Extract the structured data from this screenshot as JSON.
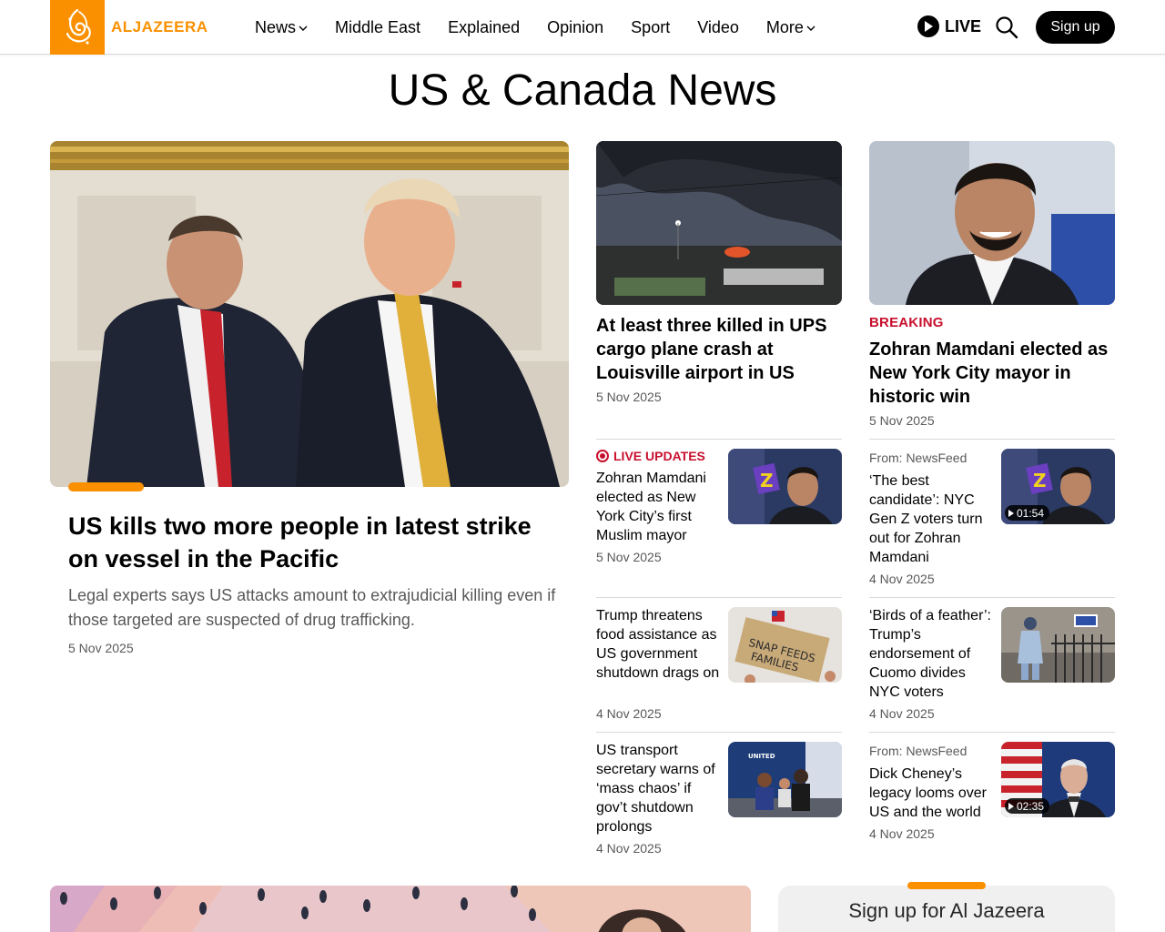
{
  "brand": {
    "logo_text": "ALJAZEERA",
    "accent_color": "#fa9000",
    "breaking_color": "#c8102e"
  },
  "nav": {
    "items": [
      {
        "label": "News",
        "has_dropdown": true
      },
      {
        "label": "Middle East",
        "has_dropdown": false
      },
      {
        "label": "Explained",
        "has_dropdown": false
      },
      {
        "label": "Opinion",
        "has_dropdown": false
      },
      {
        "label": "Sport",
        "has_dropdown": false
      },
      {
        "label": "Video",
        "has_dropdown": false
      },
      {
        "label": "More",
        "has_dropdown": true
      }
    ],
    "live_label": "LIVE",
    "signup_label": "Sign up",
    "icons": [
      "play-icon",
      "search-icon",
      "chevron-down-icon"
    ]
  },
  "page": {
    "title": "US & Canada News"
  },
  "hero": {
    "title": "US kills two more people in latest strike on vessel in the Pacific",
    "description": "Legal experts says US attacks amount to extrajudicial killing even if those targeted are suspected of drug trafficking.",
    "date": "5 Nov 2025"
  },
  "features": [
    {
      "label": "",
      "title": "At least three killed in UPS cargo plane crash at Louisville airport in US",
      "date": "5 Nov 2025"
    },
    {
      "label": "BREAKING",
      "title": "Zohran Mamdani elected as New York City mayor in historic win",
      "date": "5 Nov 2025"
    }
  ],
  "left_list": [
    {
      "label": "LIVE UPDATES",
      "title": "Zohran Mamdani elected as New York City’s first Muslim mayor",
      "date": "5 Nov 2025"
    },
    {
      "label": "",
      "title": "Trump threatens food assistance as US government shutdown drags on",
      "date": "4 Nov 2025"
    },
    {
      "label": "",
      "title": "US transport secretary warns of ‘mass chaos’ if gov’t shutdown prolongs",
      "date": "4 Nov 2025"
    }
  ],
  "right_list": [
    {
      "from": "From: NewsFeed",
      "title": "‘The best candidate’: NYC Gen Z voters turn out for Zohran Mamdani",
      "date": "4 Nov 2025",
      "duration": "01:54"
    },
    {
      "from": "",
      "title": "‘Birds of a feather’: Trump’s endorsement of Cuomo divides NYC voters",
      "date": "4 Nov 2025",
      "duration": ""
    },
    {
      "from": "From: NewsFeed",
      "title": "Dick Cheney’s legacy looms over US and the world",
      "date": "4 Nov 2025",
      "duration": "02:35"
    }
  ],
  "newsletter": {
    "title": "Sign up for Al Jazeera"
  }
}
